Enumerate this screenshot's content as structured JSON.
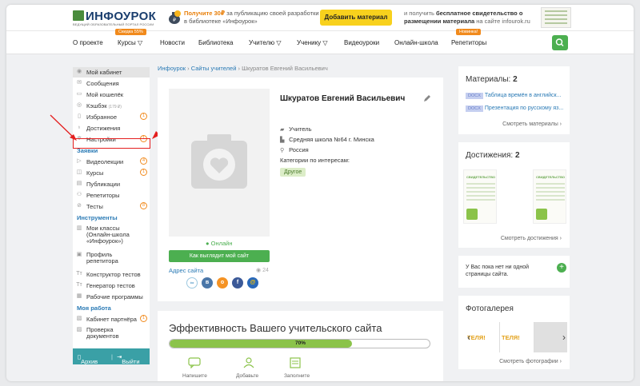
{
  "brand": {
    "logo": "ИНФОУРОК",
    "tagline": "ВЕДУЩИЙ ОБРАЗОВАТЕЛЬНЫЙ ПОРТАЛ РОССИИ"
  },
  "promo": {
    "lead": "Получите 30₽",
    "rest": " за публикацию своей разработки в библиотеке «Инфоурок»",
    "button": "Добавить материал",
    "cert_pre": "и получить ",
    "cert_bold": "бесплатное свидетельство о размещении материала",
    "cert_post": " на сайте infourok.ru"
  },
  "nav": {
    "items": [
      "О проекте",
      "Курсы ▽",
      "Новости",
      "Библиотека",
      "Учителю ▽",
      "Ученику ▽",
      "Видеоуроки",
      "Онлайн-школа",
      "Репетиторы"
    ],
    "sale_badge": "Скидка 55%",
    "new_badge": "Новинка!"
  },
  "sidebar": {
    "cabinet": "Мой кабинет",
    "messages": "Сообщения",
    "wallet": "Мой кошелёк",
    "cashback": "Кэшбэк",
    "cashback_amount": "(179 ₽)",
    "favorites": "Избранное",
    "favorites_count": "1",
    "achievements": "Достижения",
    "settings": "Настройки",
    "settings_count": "1",
    "requests_head": "Заявки",
    "videolectures": "Видеолекции",
    "videolectures_count": "4",
    "courses": "Курсы",
    "courses_count": "1",
    "publications": "Публикации",
    "tutors": "Репетиторы",
    "tests": "Тесты",
    "tests_count": "8",
    "tools_head": "Инструменты",
    "my_classes_1": "Мои классы",
    "my_classes_2": "(Онлайн-школа",
    "my_classes_3": "«Инфоурок»)",
    "tutor_profile_1": "Профиль",
    "tutor_profile_2": "репетитора",
    "test_builder": "Конструктор тестов",
    "test_generator": "Генератор тестов",
    "work_programs": "Рабочие программы",
    "work_head": "Моя работа",
    "partner": "Кабинет партнёра",
    "partner_count": "1",
    "docs_check_1": "Проверка",
    "docs_check_2": "документов",
    "archive": "Архив",
    "logout": "Выйти"
  },
  "breadcrumb": {
    "root": "Инфоурок",
    "sites": "Сайты учителей",
    "current": "Шкуратов Евгений Васильевич",
    "sep": " › "
  },
  "profile": {
    "name": "Шкуратов Евгений Васильевич",
    "role": "Учитель",
    "school": "Средняя школа №64 г. Минска",
    "country": "Россия",
    "interests_label": "Категории по интересам:",
    "interest_tag": "Другое",
    "online": "● Онлайн",
    "view_button": "Как выглядит мой сайт",
    "site_address": "Адрес сайта",
    "views": "24"
  },
  "effectiveness": {
    "title": "Эффективность Вашего учительского сайта",
    "progress_percent": 70,
    "progress_label": "70%",
    "steps": [
      "Напишите",
      "Добавьте",
      "Заполните"
    ]
  },
  "materials": {
    "title": "Материалы: ",
    "count": "2",
    "items": [
      {
        "tag": "DOCX",
        "title": "Таблица времён в английск..."
      },
      {
        "tag": "DOCX",
        "title": "Презентация по русскому яз..."
      }
    ],
    "link": "Смотреть материалы ›"
  },
  "achievements": {
    "title": "Достижения: ",
    "count": "2",
    "cert_label": "СВИДЕТЕЛЬСТВО",
    "link": "Смотреть достижения ›"
  },
  "pages": {
    "text_1": "У Вас пока нет ни одной",
    "text_2": "страницы сайта."
  },
  "gallery": {
    "title": "Фотогалерея",
    "slide_text": "ТЕЛЯ!",
    "link": "Смотреть фотографии ›"
  },
  "colors": {
    "accent_green": "#4caf50",
    "link_blue": "#2a7ab5",
    "orange": "#f18a1c",
    "highlight_red": "#e41f1f"
  }
}
